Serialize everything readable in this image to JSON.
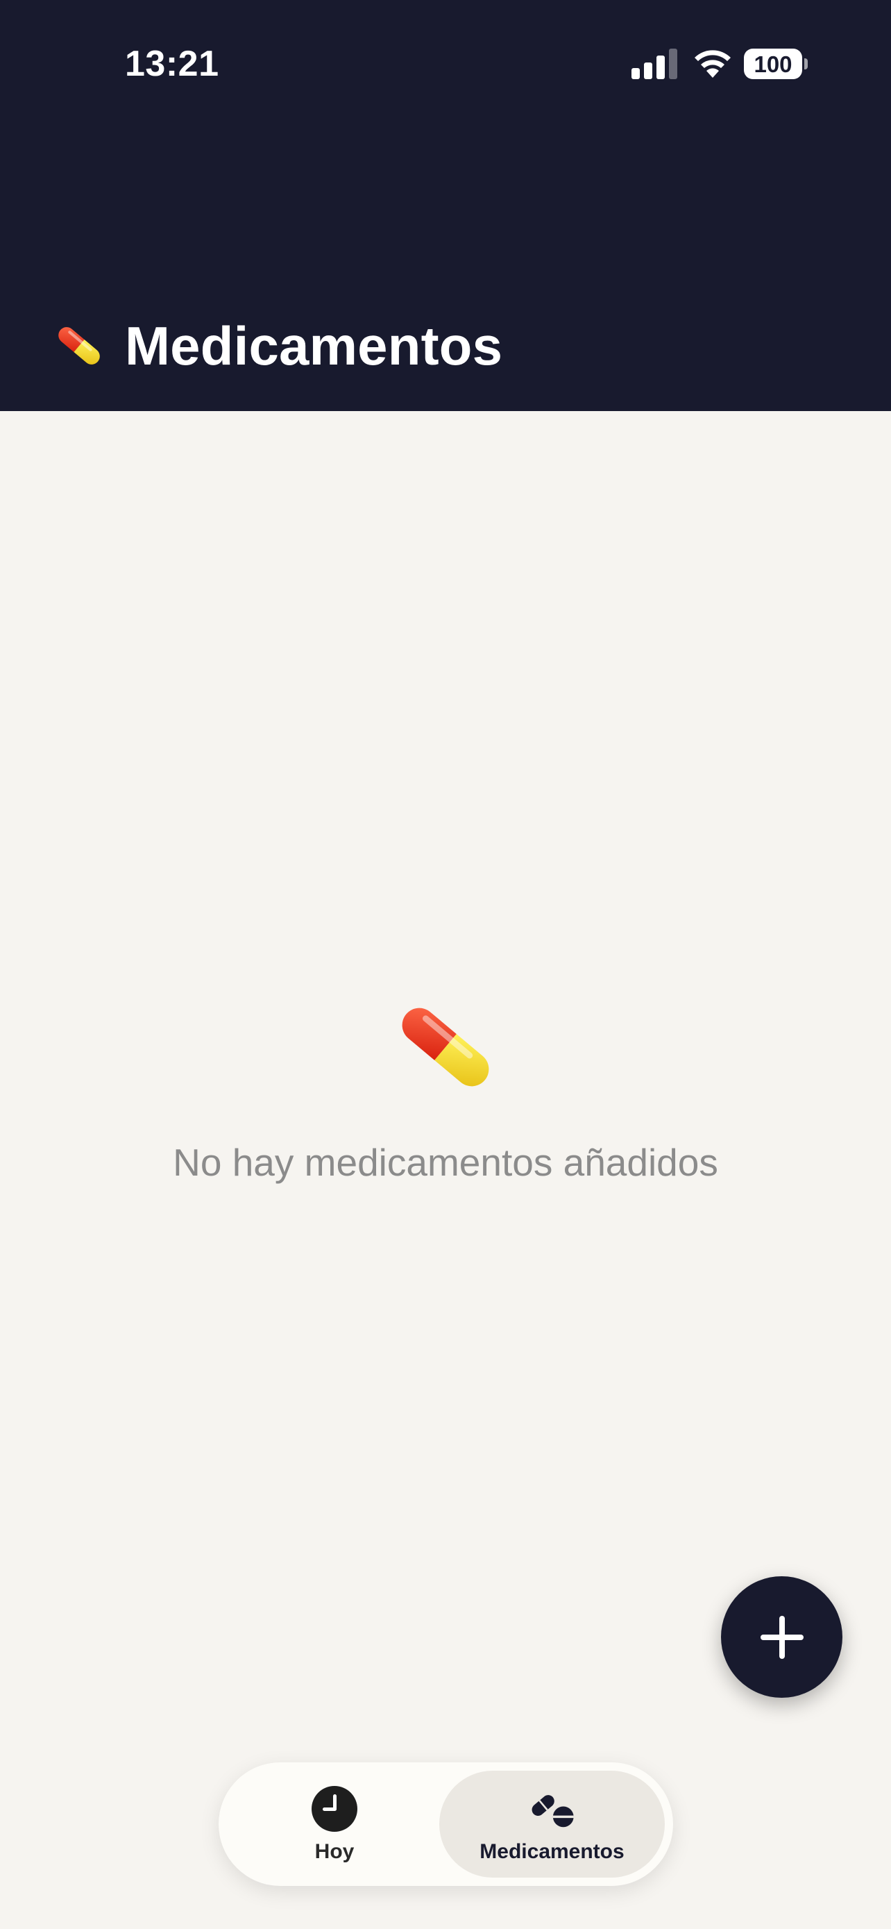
{
  "status_bar": {
    "time": "13:21",
    "battery_level": "100",
    "icons": [
      "signal-icon",
      "wifi-icon",
      "battery-icon"
    ]
  },
  "header": {
    "icon": "pill-icon",
    "title": "Medicamentos"
  },
  "empty_state": {
    "icon": "pill-icon",
    "message": "No hay medicamentos añadidos"
  },
  "fab": {
    "icon": "plus-icon"
  },
  "tab_bar": {
    "tabs": [
      {
        "label": "Hoy",
        "icon": "clock-icon",
        "active": false
      },
      {
        "label": "Medicamentos",
        "icon": "pills-icon",
        "active": true
      }
    ]
  },
  "colors": {
    "header_bg": "#181a2e",
    "page_bg": "#f6f4f0",
    "muted_text": "#8b8b8b",
    "pill_red": "#e5321c",
    "pill_yellow": "#f2d41b",
    "active_tab_bg": "#ebe8e2"
  }
}
